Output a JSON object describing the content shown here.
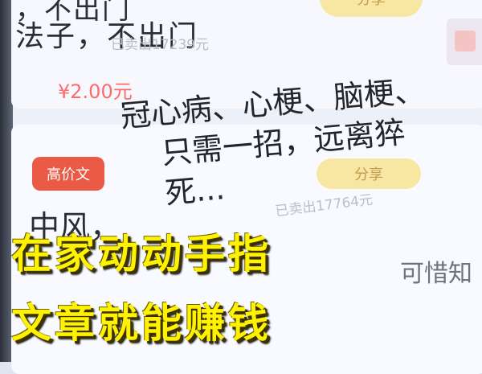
{
  "top_card": {
    "text_line1": "，不出门",
    "text_line2": "法子，不出门",
    "sold": "已卖出17239元",
    "price": "¥2.00元",
    "share_label": "分享"
  },
  "main_card": {
    "badge": "高价文",
    "title_line1": "冠心病、心梗、脑梗、",
    "title_line2": "只需一招，远离猝死...",
    "text_start": "中风，",
    "sold": "已卖出17764元",
    "share_label": "分享",
    "alt_title": "可惜知"
  },
  "overlay": {
    "line1": "在家动动手指",
    "line2": "文章就能赚钱"
  }
}
